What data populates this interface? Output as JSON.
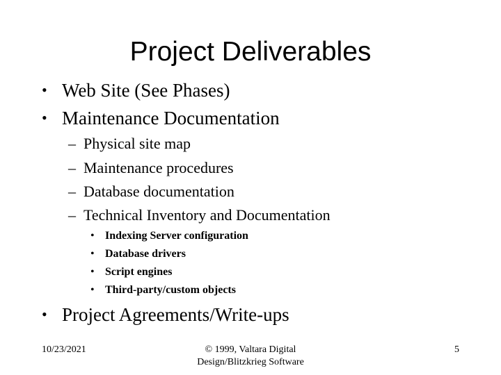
{
  "slide": {
    "title": "Project Deliverables",
    "bullets_top": [
      {
        "marker": "•",
        "text": "Web Site (See Phases)"
      },
      {
        "marker": "•",
        "text": "Maintenance Documentation"
      }
    ],
    "sub_bullets": [
      {
        "marker": "–",
        "text": "Physical site map"
      },
      {
        "marker": "–",
        "text": "Maintenance procedures"
      },
      {
        "marker": "–",
        "text": "Database documentation"
      },
      {
        "marker": "–",
        "text": "Technical Inventory and Documentation"
      }
    ],
    "sub_sub_bullets": [
      {
        "marker": "•",
        "text": "Indexing Server configuration"
      },
      {
        "marker": "•",
        "text": "Database drivers"
      },
      {
        "marker": "•",
        "text": "Script engines"
      },
      {
        "marker": "•",
        "text": "Third-party/custom objects"
      }
    ],
    "bullets_bottom": [
      {
        "marker": "•",
        "text": "Project Agreements/Write-ups"
      }
    ]
  },
  "footer": {
    "date": "10/23/2021",
    "copyright_line1": "© 1999, Valtara Digital",
    "copyright_line2": "Design/Blitzkrieg Software",
    "page_number": "5"
  }
}
